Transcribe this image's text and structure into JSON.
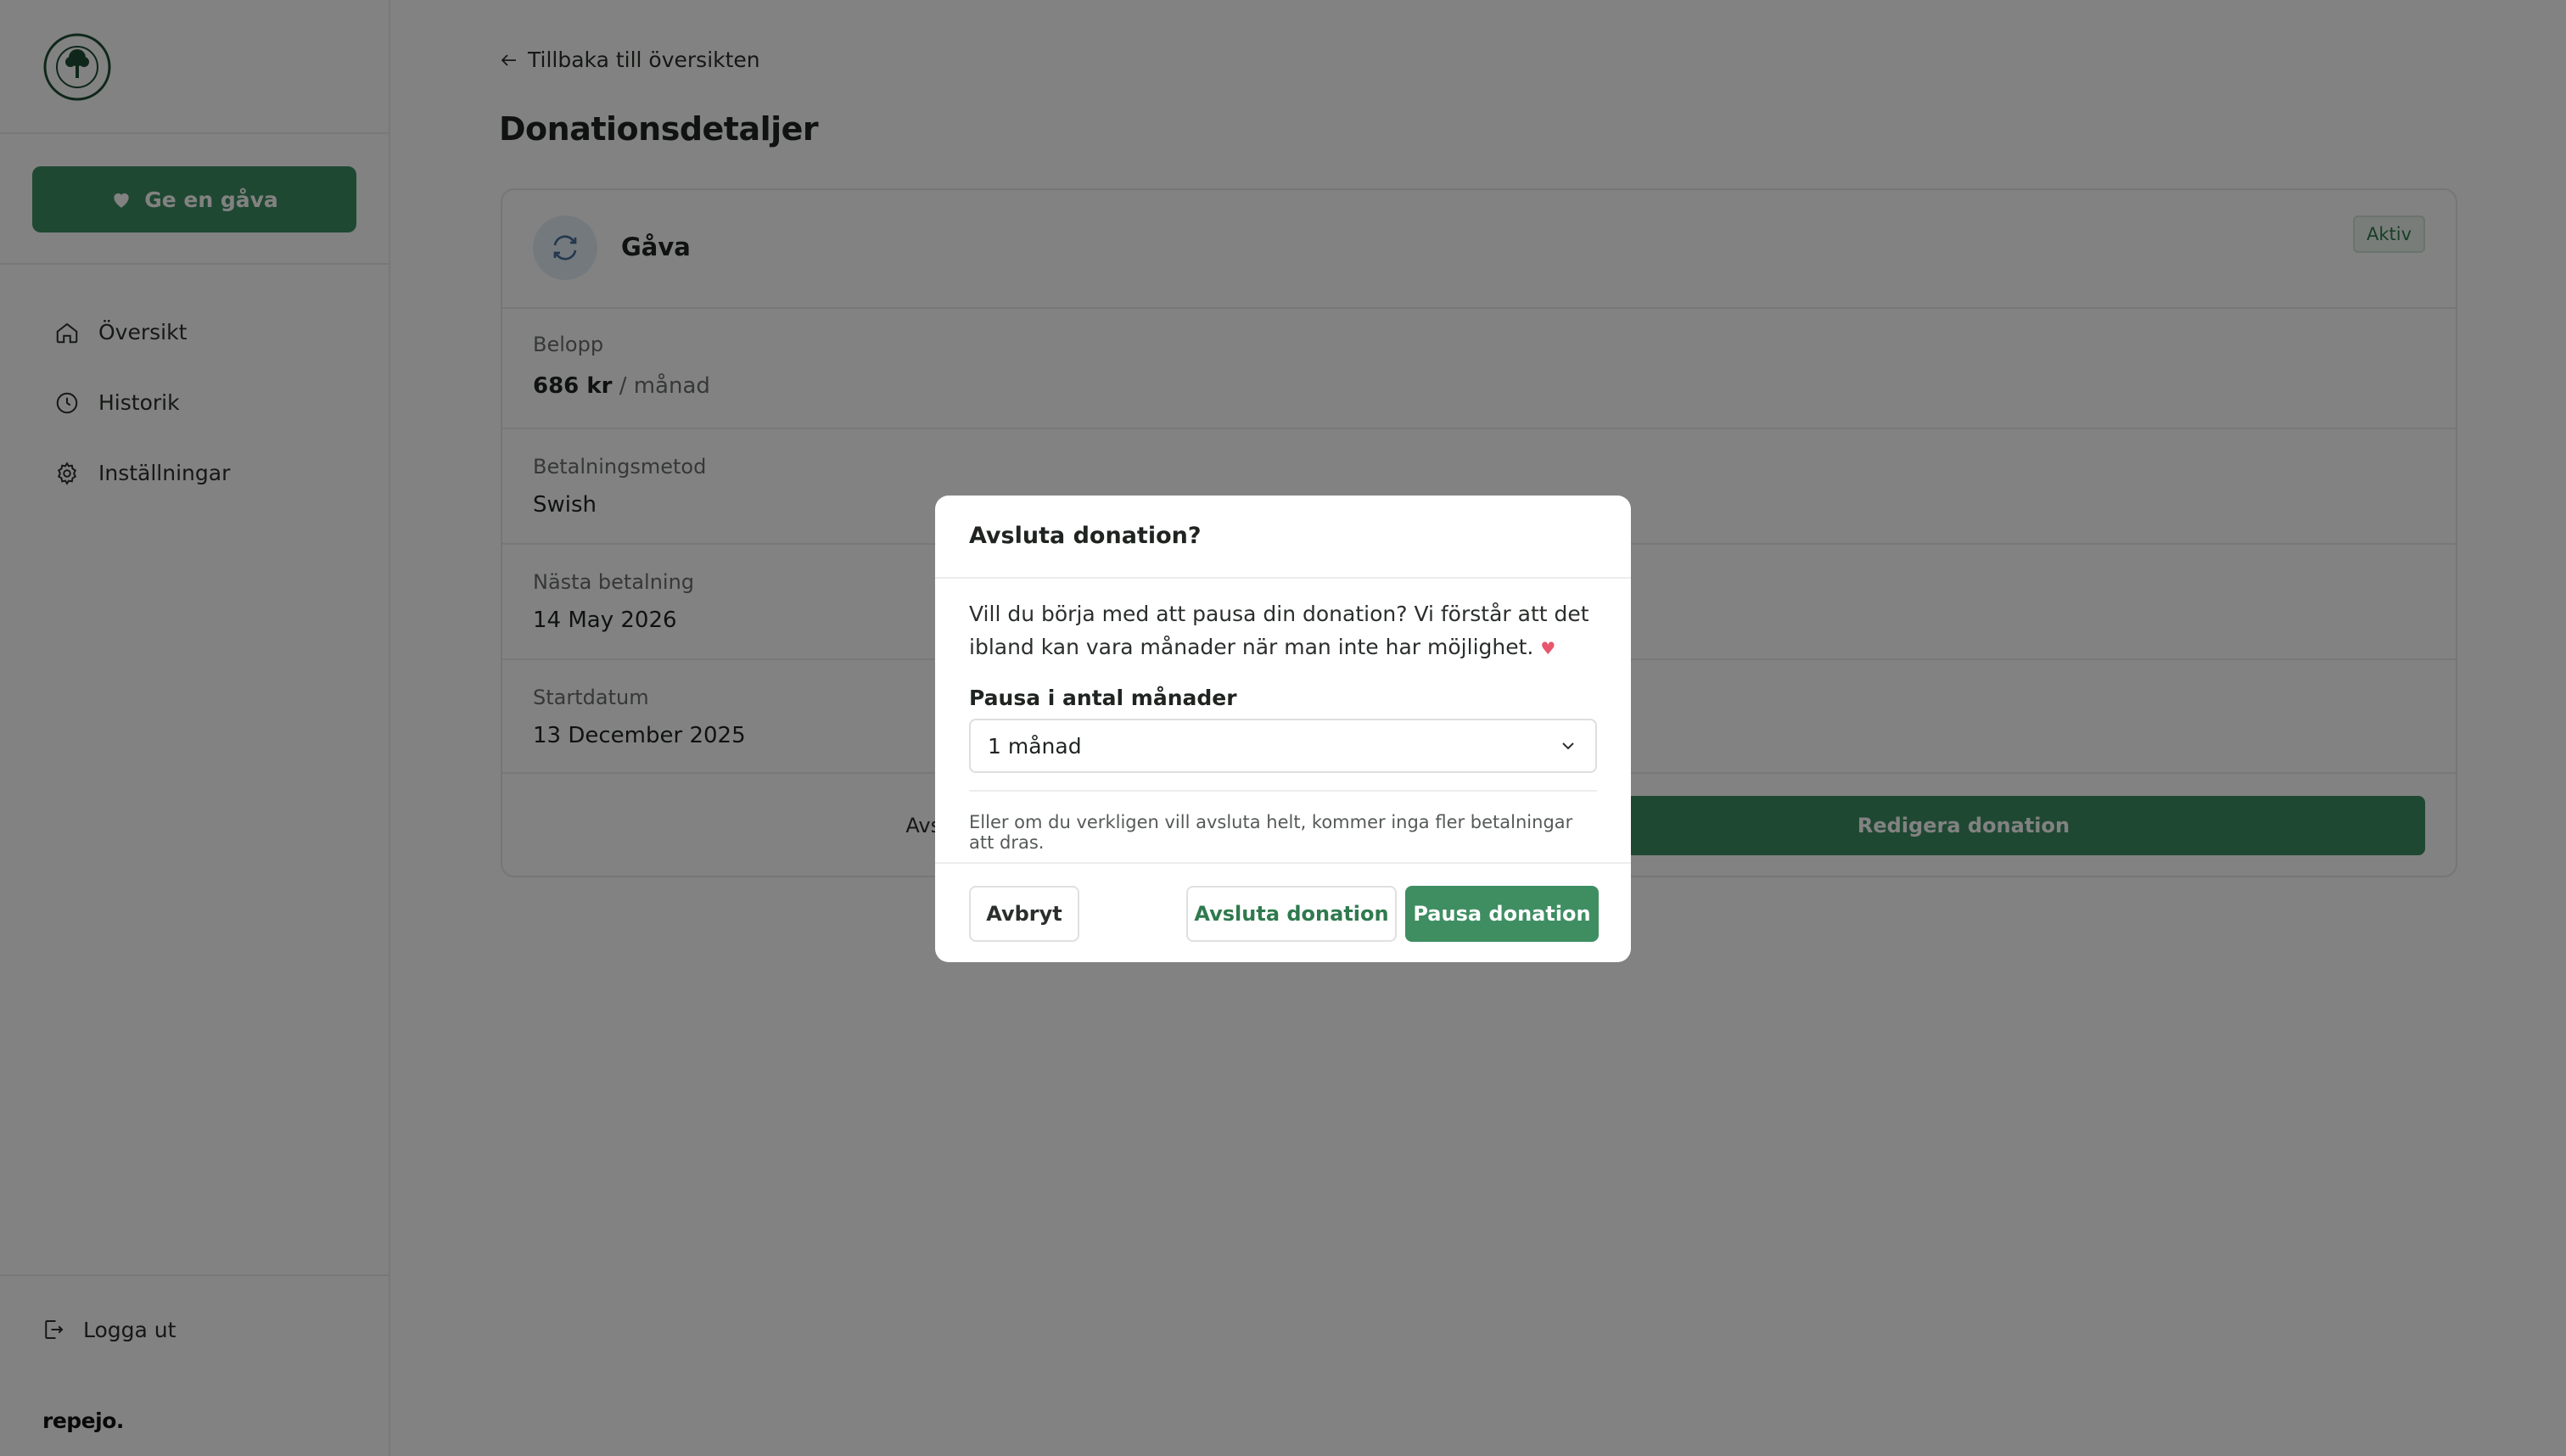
{
  "sidebar": {
    "give_label": "Ge en gåva",
    "items": [
      {
        "label": "Översikt",
        "icon": "home-icon"
      },
      {
        "label": "Historik",
        "icon": "clock-icon"
      },
      {
        "label": "Inställningar",
        "icon": "gear-icon"
      }
    ],
    "logout_label": "Logga ut",
    "brand": "repejo."
  },
  "main": {
    "back_label": "Tillbaka till översikten",
    "title": "Donationsdetaljer",
    "donation_type": "Gåva",
    "status": "Aktiv",
    "fields": {
      "amount_label": "Belopp",
      "amount_value": "686 kr",
      "amount_unit": "/ månad",
      "payment_label": "Betalningsmetod",
      "payment_value": "Swish",
      "next_label": "Nästa betalning",
      "next_value": "14 May 2026",
      "start_label": "Startdatum",
      "start_value": "13 December 2025"
    },
    "end_label": "Avsluta donation",
    "edit_label": "Redigera donation"
  },
  "modal": {
    "title": "Avsluta donation?",
    "text": "Vill du börja med att pausa din donation? Vi förstår att det ibland kan vara månader när man inte har möjlighet.",
    "heart": "♥",
    "select_label": "Pausa i antal månader",
    "select_value": "1 månad",
    "note": "Eller om du verkligen vill avsluta helt, kommer inga fler betalningar att dras.",
    "cancel_label": "Avbryt",
    "end_label": "Avsluta donation",
    "pause_label": "Pausa donation"
  },
  "colors": {
    "accent": "#3e8e62",
    "heart": "#e7566b",
    "overlay": "rgba(0,0,0,0.49)"
  }
}
